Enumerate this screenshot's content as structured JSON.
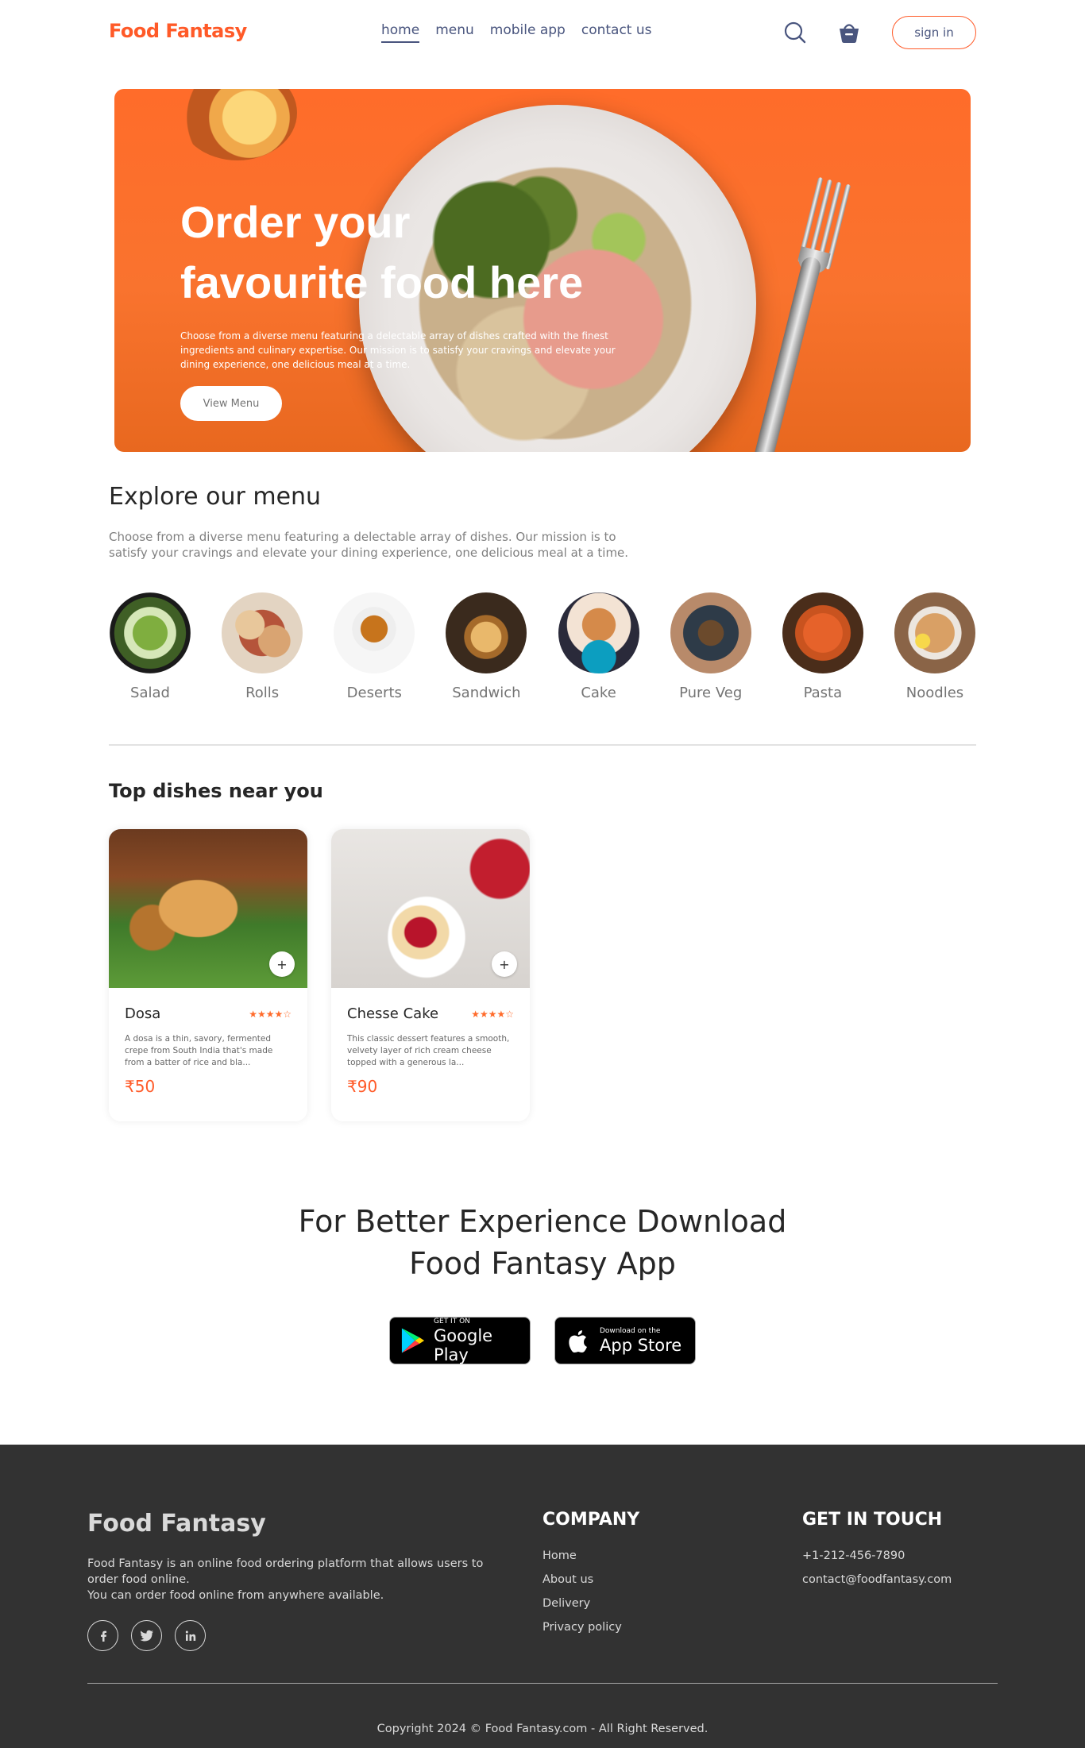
{
  "brand": {
    "name": "Food Fantasy",
    "accent": "#ff5a28",
    "nav_text_color": "#49557e"
  },
  "nav": {
    "links": [
      {
        "label": "home",
        "active": true
      },
      {
        "label": "menu",
        "active": false
      },
      {
        "label": "mobile app",
        "active": false
      },
      {
        "label": "contact us",
        "active": false
      }
    ],
    "icons": [
      "search-icon",
      "basket-icon"
    ],
    "signin_label": "sign in"
  },
  "hero": {
    "title_line1": "Order your",
    "title_line2": "favourite food here",
    "description": "Choose from a diverse menu featuring a delectable array of dishes crafted with the finest ingredients and culinary expertise. Our mission is to satisfy your cravings and elevate your dining experience, one delicious meal at a time.",
    "button_label": "View Menu"
  },
  "explore": {
    "title": "Explore our menu",
    "description": "Choose from a diverse menu featuring a delectable array of dishes. Our mission is to satisfy your cravings and elevate your dining experience, one delicious meal at a time.",
    "items": [
      {
        "label": "Salad"
      },
      {
        "label": "Rolls"
      },
      {
        "label": "Deserts"
      },
      {
        "label": "Sandwich"
      },
      {
        "label": "Cake"
      },
      {
        "label": "Pure Veg"
      },
      {
        "label": "Pasta"
      },
      {
        "label": "Noodles"
      }
    ]
  },
  "dishes": {
    "title": "Top dishes near you",
    "items": [
      {
        "name": "Dosa",
        "rating": 4,
        "stars": "★★★★☆",
        "description": "A dosa is a thin, savory, fermented crepe from South India that's made from a batter of rice and bla...",
        "price": "₹50",
        "add_symbol": "+"
      },
      {
        "name": "Chesse Cake",
        "rating": 4,
        "stars": "★★★★☆",
        "description": "This classic dessert features a smooth, velvety layer of rich cream cheese topped with a generous la...",
        "price": "₹90",
        "add_symbol": "+"
      }
    ]
  },
  "app_download": {
    "title_line1": "For Better Experience Download",
    "title_line2": "Food Fantasy App",
    "google_small": "GET IT ON",
    "google_big": "Google Play",
    "apple_small": "Download on the",
    "apple_big": "App Store"
  },
  "footer": {
    "logo": "Food Fantasy",
    "description_line1": "Food Fantasy is an online food ordering platform that allows users to order food online.",
    "description_line2": "You can order food online from anywhere available.",
    "social": [
      {
        "icon": "facebook-icon",
        "glyph": "f"
      },
      {
        "icon": "twitter-icon",
        "glyph": "🐦"
      },
      {
        "icon": "linkedin-icon",
        "glyph": "in"
      }
    ],
    "company_title": "COMPANY",
    "company_links": [
      "Home",
      "About us",
      "Delivery",
      "Privacy policy"
    ],
    "contact_title": "GET IN TOUCH",
    "phone": "+1-212-456-7890",
    "email": "contact@foodfantasy.com",
    "copyright": "Copyright 2024 © Food Fantasy.com - All Right Reserved."
  }
}
